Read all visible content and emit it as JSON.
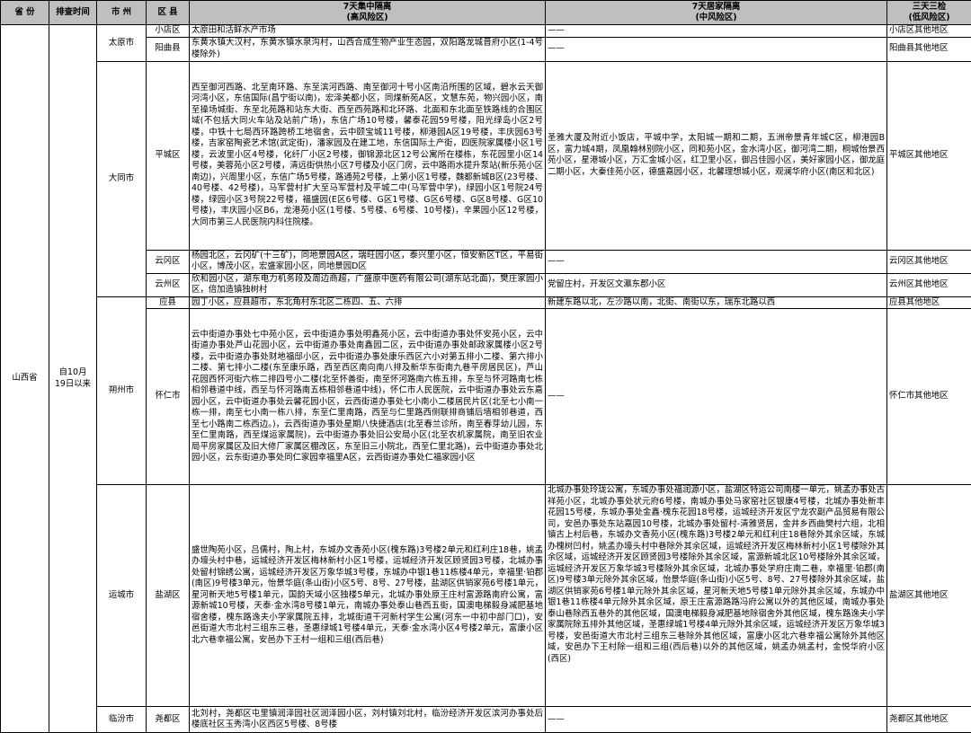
{
  "header": {
    "province": "省 份",
    "check_time": "排查时间",
    "city": "市 州",
    "district": "区 县",
    "col_high_1": "7天集中隔离",
    "col_high_2": "(高风险区)",
    "col_mid_1": "7天居家隔离",
    "col_mid_2": "(中风险区)",
    "col_low_1": "三天三检",
    "col_low_2": "(低风险区)"
  },
  "province": "山西省",
  "check_time_1": "自10月",
  "check_time_2": "19日以来",
  "rows": [
    {
      "city": "太原市",
      "district": "小店区",
      "high": "太原田和活鲜水产市场",
      "mid": "——",
      "low": "小店区其他地区"
    },
    {
      "district": "阳曲县",
      "high": "东黄水镇大汉村，东黄水镇水泉沟村，山西合成生物产业生态园，双阳路龙城晋府小区(1-4号楼除外)",
      "mid": "——",
      "low": "阳曲县其他地区"
    },
    {
      "city": "大同市",
      "district": "平城区",
      "high": "西至御河西路、北至南环路、东至滨河西路、南至御河十号小区南沿所围的区域，碧水云天御河湾小区，东信国际(昌宁街以南)，宏泽美都小区，同煤新苑A区，文慧东苑，物兴园小区，南至操场城街、东至北苑路和站东大街、西至西苑路和北环路、北面和东北面至铁路线的合围区域(不包括大同火车站及站前广场)，东信广场10号楼，馨泰花园59号楼，阳光绿岛小区2号楼，中铁十七局西环路跨桥工地宿舍，云中颐宝城11号楼，柳港园A区19号楼，丰庆园63号楼，吉家窑陶瓷艺术馆(武定街)，潘家园及在建工地，东信国际土产街，四医院家属楼小区1号楼，云波里小区4号楼，化纤厂小区2号楼，御锦源北区12号公寓所在楼栋，东花园里小区14号楼，美蓉苑小区2号楼，清远街供热小区7号楼及小区门房，云中路雨水提升泵站(新乐苑小区南边)，兴周里小区，东信广场5号楼，路通苑2号楼，上第小区1号楼，魏都新城B区(23号楼、40号楼、42号楼)，马军营村扩大至马军营村及平城二中(马军营中学)，绿园小区1号院24号楼，绿园小区3号院22号楼，福盛园(E区6号楼、G区1号楼、G区6号楼、G区8号楼、G区10号楼)，丰庆园小区B6，龙港苑小区(1号楼、5号楼、6号楼、10号楼)，辛果园小区12号楼，大同市第三人民医院内科住院楼。",
      "mid": "圣雅大厦及附近小饭店，平城中学，太阳城一期和二期，五洲帝景青年城C区，柳港园B区，富力城4期，凤凰翰林别院小区，同和苑小区，金水湾小区，御河湾二期，桐城怡景西苑小区，星港城小区，万汇金城小区，红卫里小区，御吕佳园小区，美好家园小区，御龙庭二期小区，大秦佳苑小区，德盛嘉园小区，北馨理想城小区，观澜华府小区(南区和北区)",
      "low": "平城区其他地区"
    },
    {
      "district": "云冈区",
      "high": "杨园北区，云冈矿(十三矿)，同地景园A区，瑞旺园小区，泰兴里小区，恒安新区T区，平易街小区，博茂小区，宏盛家园小区，同地景园D区",
      "mid": "——",
      "low": "云冈区其他地区"
    },
    {
      "district": "云州区",
      "high": "欣和园小区，湖东电力机务段及周边商超，广盛原中医药有限公司(湖东站北面)，樊庄家园小区，倍加造镇独树村",
      "mid": "党留庄村，开发区文瀛东郡小区",
      "low": "云州区其他地区"
    },
    {
      "city": "朔州市",
      "district": "应县",
      "high": "园丁小区，应县超市，东北角村东北区二栋四、五、六排",
      "mid": "新建东路以北，左沙路以南，北街、南街以东，瑞东北路以西",
      "low": "应县其他地区"
    },
    {
      "district": "怀仁市",
      "high": "云中街道办事处七中苑小区，云中街道办事处明鑫苑小区，云中街道办事处怀安苑小区，云中街道办事处芦山花园小区，云中街道办事处南鑫园二区，云中街道办事处邮政家属楼小区2号楼，云中街道办事处财地福邸小区，云中街道办事处康乐西区六小对第五排小二楼、第六排小二楼、第七排小二楼(东至康乐路，西至西区南向南八排及新华东街南九巷平房居民区)，芦山花园西怀河街六栋二排四号小二楼(北至怀善街，南至怀河路南六栋五排，东至与怀河路南七栋相邻巷道中线，西至与怀河路南五栋相邻巷道中线)，怀仁市人民医院，云中街道办事处云东嘉园小区，云中街道办事处云馨花园小区，云西街道办事处七小南小二楼居民片区(北至七小南一栋一排，南至七小南一栋八排，东至仁里南路，西至与仁里路西侧联排商铺后墙相邻巷道，西至七小路南二栋西边。)，云西街道办事处星期八快捷酒店(北至春兰诊所，南至春芽幼儿园，东至仁里南路，西至煤运家属院)，云中街道办事处旧公安局小区(北至农机家属院，南至旧农业局平房家属区及旧大修厂家属区棚改区，东至旧三小院北，西至仁里北路)，云中街道办事处北园小区，云东街道办事处同仁家园幸福里A区，云西街道办事处仁福家园小区",
      "mid": "——",
      "low": "怀仁市其他地区"
    },
    {
      "city": "运城市",
      "district": "盐湖区",
      "high": "盛世陶苑小区，吕儒村，陶上村，东城办文香苑小区(槐东路)3号楼2单元和红利庄18巷，姚孟办壕头村中巷，运城经济开发区梅林新村小区1号楼，运城经济开发区顾贤园3号楼，北城办事处留村锦绣公寓，运城经济开发区万象华城3号楼，东城办中银1巷11栋楼4单元，幸福里·铂郡(南区)9号楼3单元，怡景华庭(条山街)小区5号、8号、27号楼，盐湖区供销家苑6号楼1单元，星河新天地5号楼1单元，国韵天域小区独楼5单元，北城办事处原王庄村富源路南府公寓，富源新城10号楼，天泰·金水湾8号楼1单元，南城办事处泰山巷西五街，国澳电梯毅身减肥基地宿舍楼，槐东路逸夫小学家属院五排，北城街道干河新村学生公寓(河东一中初中部门口)，安邑街道大市北村三组东三巷，圣惠绿城1号楼4单元，天泰·金水湾小区4号楼2单元，富康小区北六巷幸福公寓，安邑办下王村一组和三组(西后巷)",
      "mid": "北城办事处玲珑公寓，东城办事处福润源小区，盐湖区特运公司南楼一单元，姚孟办事处古祥苑小区，北城办事处状元府6号楼，南城办事处马家窑社区银康4号楼，北城办事处新丰花园15号楼，东城办事处金鑫·槐东花园18号楼，运城经济开发区宁龙农副产品贸易有限公司，安邑办事处东站嘉园10号楼，北城办事处留村-清雅贤居，金井乡西曲樊村六组，北相镇古上村后巷，东城办文香苑小区(槐东路)3号楼2单元和红利庄18巷除外其余区域，东城办槐树凹村，姚孟办壕头村中巷除外其余区域，运城经济开发区梅林新村小区1号楼除外其余区域，运城经济开发区顾贤园3号楼除外其余区域，富源新城北区10号楼除外其余区域，运城经济开发区万象华城3号楼除外其余区域，北城办事处学府庄南二巷，幸福里·铂郡(南区)9号楼3单元除外其余区域，怡景华庭(条山街)小区5号、8号、27号楼除外其余区域，盐湖区供销家苑6号楼1单元除外其余区域，星河新天地5号楼1单元除外其余区域，东城办中银1巷11栋楼4单元除外其余区域，原王庄富源路路冯府公寓以外的其他区域，南城办事处泰山巷除西五巷外的其他区域，国澳电梯毅身减肥基地除宿舍外其他区域，槐东路逸夫小学家属院除五排外其他区域，圣惠绿城1号楼4单元除外其余区域，运城经济开发区万象华城3号楼，安邑街道大市北村三组东三巷除外其他区域，富康小区北六巷幸福公寓除外其他区域，安邑办下王村除一组和三组(西后巷)以外的其他区域，姚孟办姚孟村，金悦华府小区(西区)",
      "low": "盐湖区其他地区"
    },
    {
      "city": "临汾市",
      "district": "尧都区",
      "high": "北刘村，尧都区屯里镇润泽园社区润泽园小区，刘村镇刘北村，临汾经济开发区滨河办事处后楼底社区玉秀湾小区西区5号楼、8号楼",
      "mid": "——",
      "low": "尧都区其他地区"
    }
  ]
}
